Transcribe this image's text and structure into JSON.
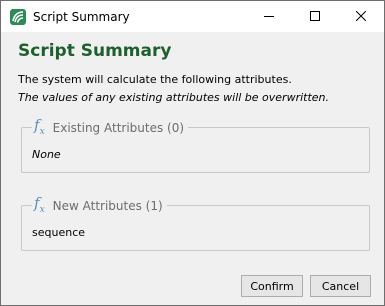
{
  "window": {
    "title": "Script Summary",
    "minimize_icon": "minimize-icon",
    "maximize_icon": "maximize-icon",
    "close_icon": "close-icon"
  },
  "dialog": {
    "heading": "Script Summary",
    "description": "The system will calculate the following attributes.",
    "warning": "The values of any existing attributes will be overwritten."
  },
  "groups": [
    {
      "icon": "function-icon",
      "label": "Existing Attributes (0)",
      "content": "None"
    },
    {
      "icon": "function-icon",
      "label": "New Attributes (1)",
      "content": "sequence"
    }
  ],
  "buttons": {
    "confirm": "Confirm",
    "cancel": "Cancel"
  },
  "colors": {
    "heading": "#1e5f2e",
    "icon": "#5a8fc0",
    "app_icon": "#2e8b57"
  }
}
